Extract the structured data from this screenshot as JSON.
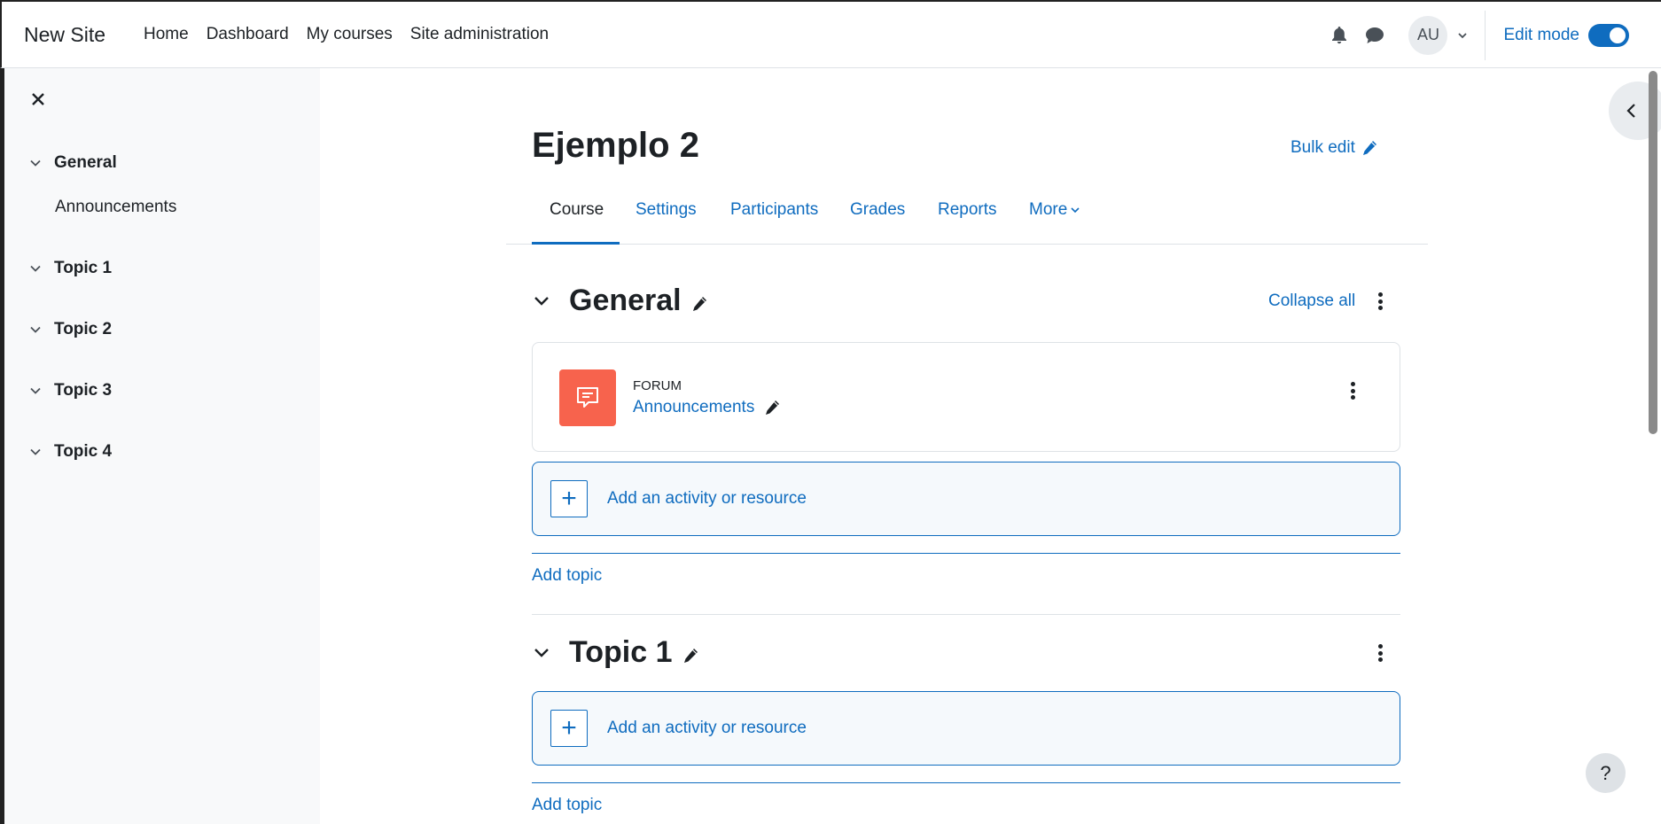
{
  "header": {
    "brand": "New Site",
    "nav": [
      "Home",
      "Dashboard",
      "My courses",
      "Site administration"
    ],
    "user_initials": "AU",
    "edit_mode_label": "Edit mode",
    "edit_mode_on": true
  },
  "drawer": {
    "sections": [
      {
        "title": "General",
        "items": [
          "Announcements"
        ]
      },
      {
        "title": "Topic 1"
      },
      {
        "title": "Topic 2"
      },
      {
        "title": "Topic 3"
      },
      {
        "title": "Topic 4"
      }
    ]
  },
  "course": {
    "title": "Ejemplo 2",
    "bulk_edit": "Bulk edit",
    "tabs": [
      "Course",
      "Settings",
      "Participants",
      "Grades",
      "Reports",
      "More"
    ],
    "active_tab": "Course",
    "collapse_all": "Collapse all"
  },
  "sections": [
    {
      "name": "General",
      "activity": {
        "type": "FORUM",
        "name": "Announcements"
      },
      "add_activity": "Add an activity or resource",
      "add_topic": "Add topic"
    },
    {
      "name": "Topic 1",
      "add_activity": "Add an activity or resource",
      "add_topic": "Add topic"
    }
  ],
  "help_label": "?",
  "colors": {
    "link": "#0f6cbf",
    "forum_icon_bg": "#f7634d",
    "drawer_bg": "#f8f9fa"
  }
}
